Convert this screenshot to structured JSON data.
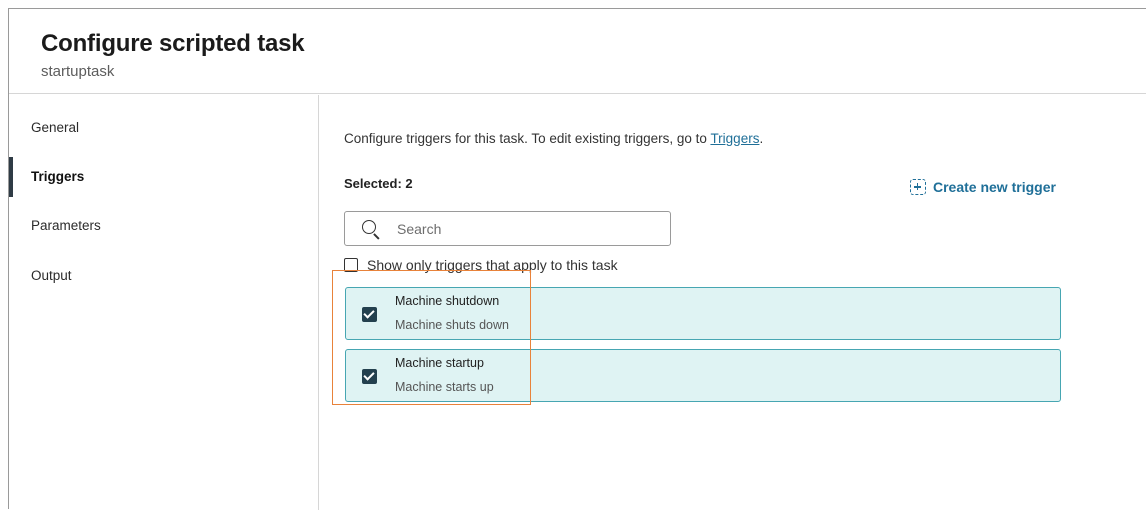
{
  "header": {
    "title": "Configure scripted task",
    "subtitle": "startuptask"
  },
  "sidebar": {
    "items": [
      {
        "label": "General",
        "active": false
      },
      {
        "label": "Triggers",
        "active": true
      },
      {
        "label": "Parameters",
        "active": false
      },
      {
        "label": "Output",
        "active": false
      }
    ]
  },
  "main": {
    "intro_text": "Configure triggers for this task. To edit existing triggers, go to ",
    "intro_link": "Triggers",
    "intro_end": ".",
    "selected_label": "Selected: 2",
    "create_button": "Create new trigger",
    "search_placeholder": "Search",
    "filter_label": "Show only triggers that apply to this task",
    "triggers": [
      {
        "name": "Machine shutdown",
        "description": "Machine shuts down",
        "checked": true
      },
      {
        "name": "Machine startup",
        "description": "Machine starts up",
        "checked": true
      }
    ]
  },
  "colors": {
    "accent": "#1f6f98",
    "trigger_bg": "#dff3f3",
    "trigger_border": "#46a6b2",
    "highlight": "#e8823a"
  }
}
